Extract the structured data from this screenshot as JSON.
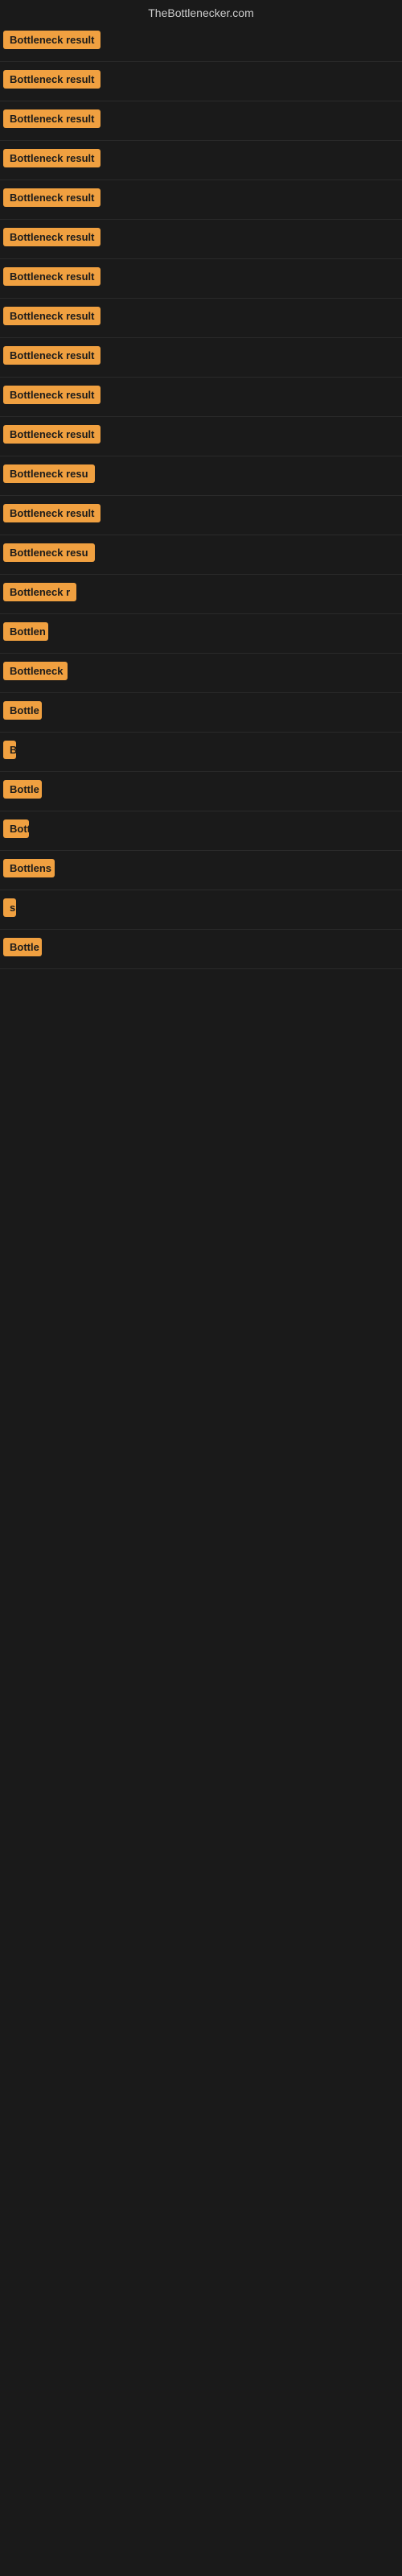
{
  "site": {
    "title": "TheBottlenecker.com"
  },
  "results": [
    {
      "label": "Bottleneck result",
      "visible_chars": 16
    },
    {
      "label": "Bottleneck result",
      "visible_chars": 16
    },
    {
      "label": "Bottleneck result",
      "visible_chars": 16
    },
    {
      "label": "Bottleneck result",
      "visible_chars": 16
    },
    {
      "label": "Bottleneck result",
      "visible_chars": 16
    },
    {
      "label": "Bottleneck result",
      "visible_chars": 16
    },
    {
      "label": "Bottleneck result",
      "visible_chars": 16
    },
    {
      "label": "Bottleneck result",
      "visible_chars": 16
    },
    {
      "label": "Bottleneck result",
      "visible_chars": 16
    },
    {
      "label": "Bottleneck result",
      "visible_chars": 16
    },
    {
      "label": "Bottleneck result",
      "visible_chars": 16
    },
    {
      "label": "Bottleneck resu",
      "visible_chars": 15
    },
    {
      "label": "Bottleneck result",
      "visible_chars": 16
    },
    {
      "label": "Bottleneck resu",
      "visible_chars": 15
    },
    {
      "label": "Bottleneck r",
      "visible_chars": 12
    },
    {
      "label": "Bottlen",
      "visible_chars": 7
    },
    {
      "label": "Bottleneck",
      "visible_chars": 10
    },
    {
      "label": "Bottle",
      "visible_chars": 6
    },
    {
      "label": "B",
      "visible_chars": 1
    },
    {
      "label": "Bottle",
      "visible_chars": 6
    },
    {
      "label": "Bott",
      "visible_chars": 4
    },
    {
      "label": "Bottlens",
      "visible_chars": 8
    },
    {
      "label": "s",
      "visible_chars": 1
    },
    {
      "label": "Bottle",
      "visible_chars": 6
    }
  ]
}
